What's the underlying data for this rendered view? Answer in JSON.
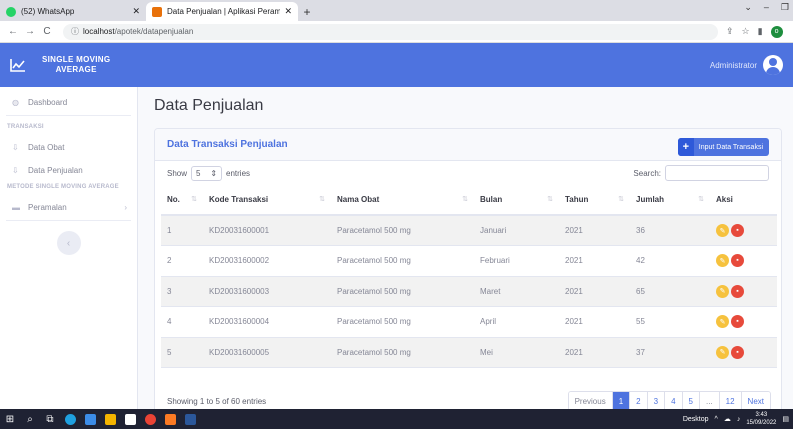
{
  "browser": {
    "tabs": [
      {
        "title": "(52) WhatsApp",
        "favicon_color": "#25d366",
        "active": false
      },
      {
        "title": "Data Penjualan | Aplikasi Perama",
        "favicon_color": "#e8710a",
        "active": true
      }
    ],
    "url_host": "localhost",
    "url_path": "/apotek/datapenjualan",
    "profile_initial": "o"
  },
  "header": {
    "brand_line1": "SINGLE MOVING",
    "brand_line2": "AVERAGE",
    "user_name": "Administrator"
  },
  "sidebar": {
    "dashboard": "Dashboard",
    "section_transaksi": "TRANSAKSI",
    "data_obat": "Data Obat",
    "data_penjualan": "Data Penjualan",
    "section_sma": "METODE SINGLE MOVING AVERAGE",
    "peramalan": "Peramalan"
  },
  "main": {
    "page_title": "Data Penjualan",
    "card_title": "Data Transaksi Penjualan",
    "input_button": "Input Data Transaksi",
    "show_label": "Show",
    "entries_value": "5",
    "entries_label": "entries",
    "search_label": "Search:",
    "columns": [
      "No.",
      "Kode Transaksi",
      "Nama Obat",
      "Bulan",
      "Tahun",
      "Jumlah",
      "Aksi"
    ],
    "rows": [
      {
        "no": "1",
        "kode": "KD20031600001",
        "nama": "Paracetamol 500 mg",
        "bulan": "Januari",
        "tahun": "2021",
        "jumlah": "36"
      },
      {
        "no": "2",
        "kode": "KD20031600002",
        "nama": "Paracetamol 500 mg",
        "bulan": "Februari",
        "tahun": "2021",
        "jumlah": "42"
      },
      {
        "no": "3",
        "kode": "KD20031600003",
        "nama": "Paracetamol 500 mg",
        "bulan": "Maret",
        "tahun": "2021",
        "jumlah": "65"
      },
      {
        "no": "4",
        "kode": "KD20031600004",
        "nama": "Paracetamol 500 mg",
        "bulan": "April",
        "tahun": "2021",
        "jumlah": "55"
      },
      {
        "no": "5",
        "kode": "KD20031600005",
        "nama": "Paracetamol 500 mg",
        "bulan": "Mei",
        "tahun": "2021",
        "jumlah": "37"
      }
    ],
    "showing_text": "Showing 1 to 5 of 60 entries",
    "pager": {
      "previous": "Previous",
      "pages": [
        "1",
        "2",
        "3",
        "4",
        "5",
        "...",
        "12"
      ],
      "next": "Next"
    }
  },
  "taskbar": {
    "desktop_label": "Desktop",
    "time": "3:43",
    "date": "15/09/2022"
  },
  "colors": {
    "primary": "#4e73df",
    "edit": "#f6c23e",
    "delete": "#e74a3b"
  }
}
